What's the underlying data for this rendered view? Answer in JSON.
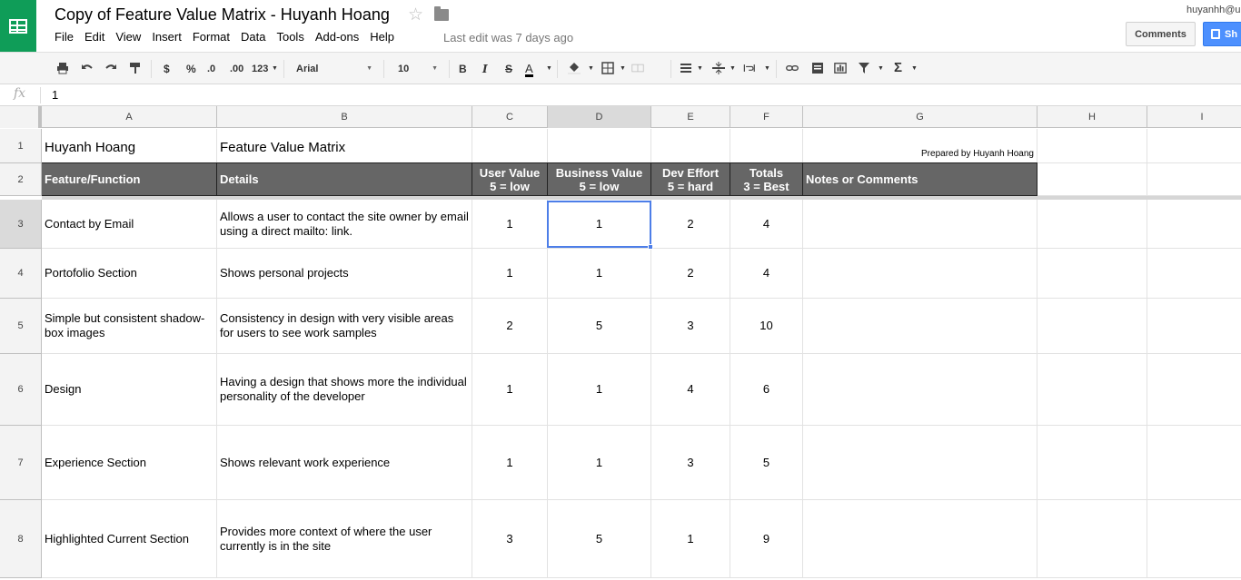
{
  "app": {
    "title": "Copy of Feature Value Matrix - Huyanh Hoang",
    "last_edit": "Last edit was 7 days ago",
    "user_email": "huyanhh@u",
    "comments_label": "Comments",
    "share_label": "Sh",
    "brand_color": "#0f9d58",
    "accent_color": "#4d90fe"
  },
  "menu": [
    "File",
    "Edit",
    "View",
    "Insert",
    "Format",
    "Data",
    "Tools",
    "Add-ons",
    "Help"
  ],
  "toolbar": {
    "currency": "$",
    "percent": "%",
    "dec_decrease": ".0",
    "dec_increase": ".00",
    "more_formats": "123",
    "font": "Arial",
    "font_size": "10",
    "bold": "B",
    "italic": "I",
    "strike": "S",
    "text_color": "A"
  },
  "formula": {
    "fx": "fx",
    "value": "1"
  },
  "columns": [
    "A",
    "B",
    "C",
    "D",
    "E",
    "F",
    "G",
    "H",
    "I"
  ],
  "rows": [
    "1",
    "2",
    "3",
    "4",
    "5",
    "6",
    "7",
    "8"
  ],
  "sheet": {
    "r1": {
      "a": "Huyanh Hoang",
      "b": "Feature Value Matrix",
      "g": "Prepared by Huyanh Hoang"
    },
    "header": {
      "a": "Feature/Function",
      "b": "Details",
      "c1": "User Value",
      "c2": "5 = low",
      "d1": "Business Value",
      "d2": "5 = low",
      "e1": "Dev Effort",
      "e2": "5 = hard",
      "f1": "Totals",
      "f2": "3 = Best",
      "g": "Notes or Comments"
    },
    "data": [
      {
        "a": "Contact by Email",
        "b": "Allows a user to contact the site owner by email using a direct mailto: link.",
        "c": "1",
        "d": "1",
        "e": "2",
        "f": "4"
      },
      {
        "a": "Portofolio Section",
        "b": "Shows personal projects",
        "c": "1",
        "d": "1",
        "e": "2",
        "f": "4"
      },
      {
        "a": "Simple but consistent shadow-box images",
        "b": "Consistency in design with very visible areas for users to see work samples",
        "c": "2",
        "d": "5",
        "e": "3",
        "f": "10"
      },
      {
        "a": "Design",
        "b": "Having a design that shows more the individual personality of the developer",
        "c": "1",
        "d": "1",
        "e": "4",
        "f": "6"
      },
      {
        "a": "Experience Section",
        "b": "Shows relevant work experience",
        "c": "1",
        "d": "1",
        "e": "3",
        "f": "5"
      },
      {
        "a": "Highlighted Current Section",
        "b": "Provides more context of where the user currently is in the site",
        "c": "3",
        "d": "5",
        "e": "1",
        "f": "9"
      }
    ]
  }
}
